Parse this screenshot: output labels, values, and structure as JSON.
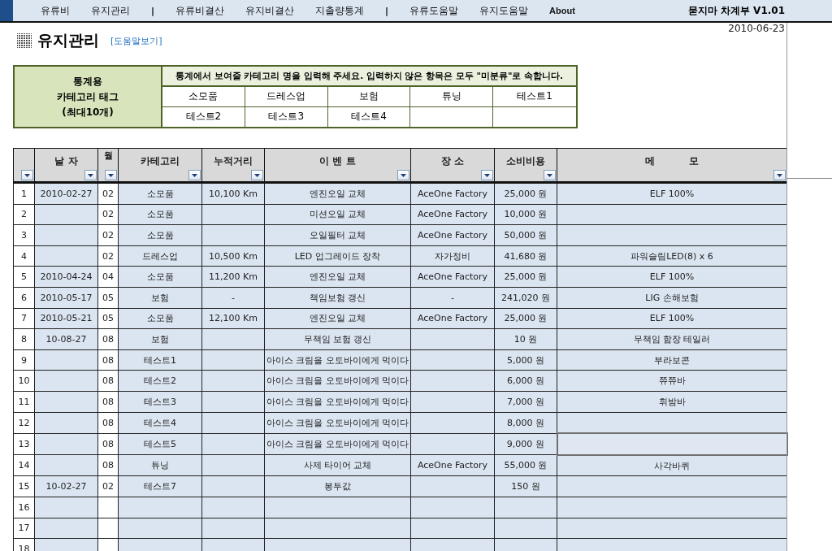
{
  "nav": {
    "items": [
      {
        "kind": "link",
        "label": "유류비"
      },
      {
        "kind": "link",
        "label": "유지관리"
      },
      {
        "kind": "separator",
        "label": "|"
      },
      {
        "kind": "link",
        "label": "유류비결산"
      },
      {
        "kind": "link",
        "label": "유지비결산"
      },
      {
        "kind": "link",
        "label": "지출량통계"
      },
      {
        "kind": "separator",
        "label": "|"
      },
      {
        "kind": "link",
        "label": "유류도움말"
      },
      {
        "kind": "link",
        "label": "유지도움말"
      },
      {
        "kind": "small",
        "label": "About"
      }
    ],
    "app_title": "묻지마 차계부 V1.01"
  },
  "date": "2010-06-23",
  "page": {
    "title": "유지관리",
    "help_link": "[도움말보기]"
  },
  "tags": {
    "heading": [
      "통계용",
      "카테고리 태그",
      "(최대10개)"
    ],
    "instruction": "통계에서 보여줄 카테고리 명을 입력해 주세요. 입력하지 않은 항목은 모두 \"미분류\"로 속합니다.",
    "items": [
      "소모품",
      "드레스업",
      "보험",
      "튜닝",
      "테스트1",
      "테스트2",
      "테스트3",
      "테스트4"
    ]
  },
  "table": {
    "columns": [
      {},
      {
        "label": "날 자"
      },
      {
        "label": "월"
      },
      {
        "label": "카테고리"
      },
      {
        "label": "누적거리"
      },
      {
        "label": "이 벤 트"
      },
      {
        "label": "장 소"
      },
      {
        "label": "소비비용"
      },
      {
        "label": "메          모"
      }
    ],
    "rows": [
      {
        "no": "1",
        "date": "2010-02-27",
        "month": "02",
        "category": "소모품",
        "distance": "10,100 Km",
        "event": "엔진오일 교체",
        "place": "AceOne Factory",
        "cost": "25,000 원",
        "memo": "ELF 100%",
        "selected": false
      },
      {
        "no": "2",
        "month": "02",
        "category": "소모품",
        "event": "미션오일 교체",
        "place": "AceOne Factory",
        "cost": "10,000 원",
        "selected": false
      },
      {
        "no": "3",
        "month": "02",
        "category": "소모품",
        "event": "오일필터 교체",
        "place": "AceOne Factory",
        "cost": "50,000 원",
        "selected": false
      },
      {
        "no": "4",
        "month": "02",
        "category": "드레스업",
        "distance": "10,500 Km",
        "event": "LED 업그레이드 장착",
        "place": "자가정비",
        "cost": "41,680 원",
        "memo": "파워슬림LED(8) x 6",
        "selected": false
      },
      {
        "no": "5",
        "date": "2010-04-24",
        "month": "04",
        "category": "소모품",
        "distance": "11,200 Km",
        "event": "엔진오일 교체",
        "place": "AceOne Factory",
        "cost": "25,000 원",
        "memo": "ELF 100%",
        "selected": false
      },
      {
        "no": "6",
        "date": "2010-05-17",
        "month": "05",
        "category": "보험",
        "distance": "-",
        "event": "책임보험 갱신",
        "place": "-",
        "cost": "241,020 원",
        "memo": "LIG 손해보험",
        "selected": false
      },
      {
        "no": "7",
        "date": "2010-05-21",
        "month": "05",
        "category": "소모품",
        "distance": "12,100 Km",
        "event": "엔진오일 교체",
        "place": "AceOne Factory",
        "cost": "25,000 원",
        "memo": "ELF 100%",
        "selected": false
      },
      {
        "no": "8",
        "date": "10-08-27",
        "month": "08",
        "category": "보험",
        "event": "무책임 보험 갱신",
        "cost": "10 원",
        "memo": "무책임 함장 테일러",
        "selected": false
      },
      {
        "no": "9",
        "month": "08",
        "category": "테스트1",
        "event": "아이스 크림을 오토바이에게 먹이다",
        "cost": "5,000 원",
        "memo": "부라보콘",
        "selected": false
      },
      {
        "no": "10",
        "month": "08",
        "category": "테스트2",
        "event": "아이스 크림을 오토바이에게 먹이다",
        "cost": "6,000 원",
        "memo": "쮸쮸바",
        "selected": false
      },
      {
        "no": "11",
        "month": "08",
        "category": "테스트3",
        "event": "아이스 크림을 오토바이에게 먹이다",
        "cost": "7,000 원",
        "memo": "휘밤바",
        "selected": false
      },
      {
        "no": "12",
        "month": "08",
        "category": "테스트4",
        "event": "아이스 크림을 오토바이에게 먹이다",
        "cost": "8,000 원",
        "selected": false
      },
      {
        "no": "13",
        "month": "08",
        "category": "테스트5",
        "event": "아이스 크림을 오토바이에게 먹이다",
        "cost": "9,000 원",
        "selected": true
      },
      {
        "no": "14",
        "month": "08",
        "category": "튜닝",
        "event": "사제 타이어 교체",
        "place": "AceOne Factory",
        "cost": "55,000 원",
        "memo": "사각바퀴",
        "selected": false
      },
      {
        "no": "15",
        "date": "10-02-27",
        "month": "02",
        "category": "테스트7",
        "event": "봉투값",
        "cost": "150 원",
        "selected": false
      },
      {
        "no": "16",
        "selected": false
      },
      {
        "no": "17",
        "selected": false
      },
      {
        "no": "18",
        "selected": false
      }
    ]
  }
}
